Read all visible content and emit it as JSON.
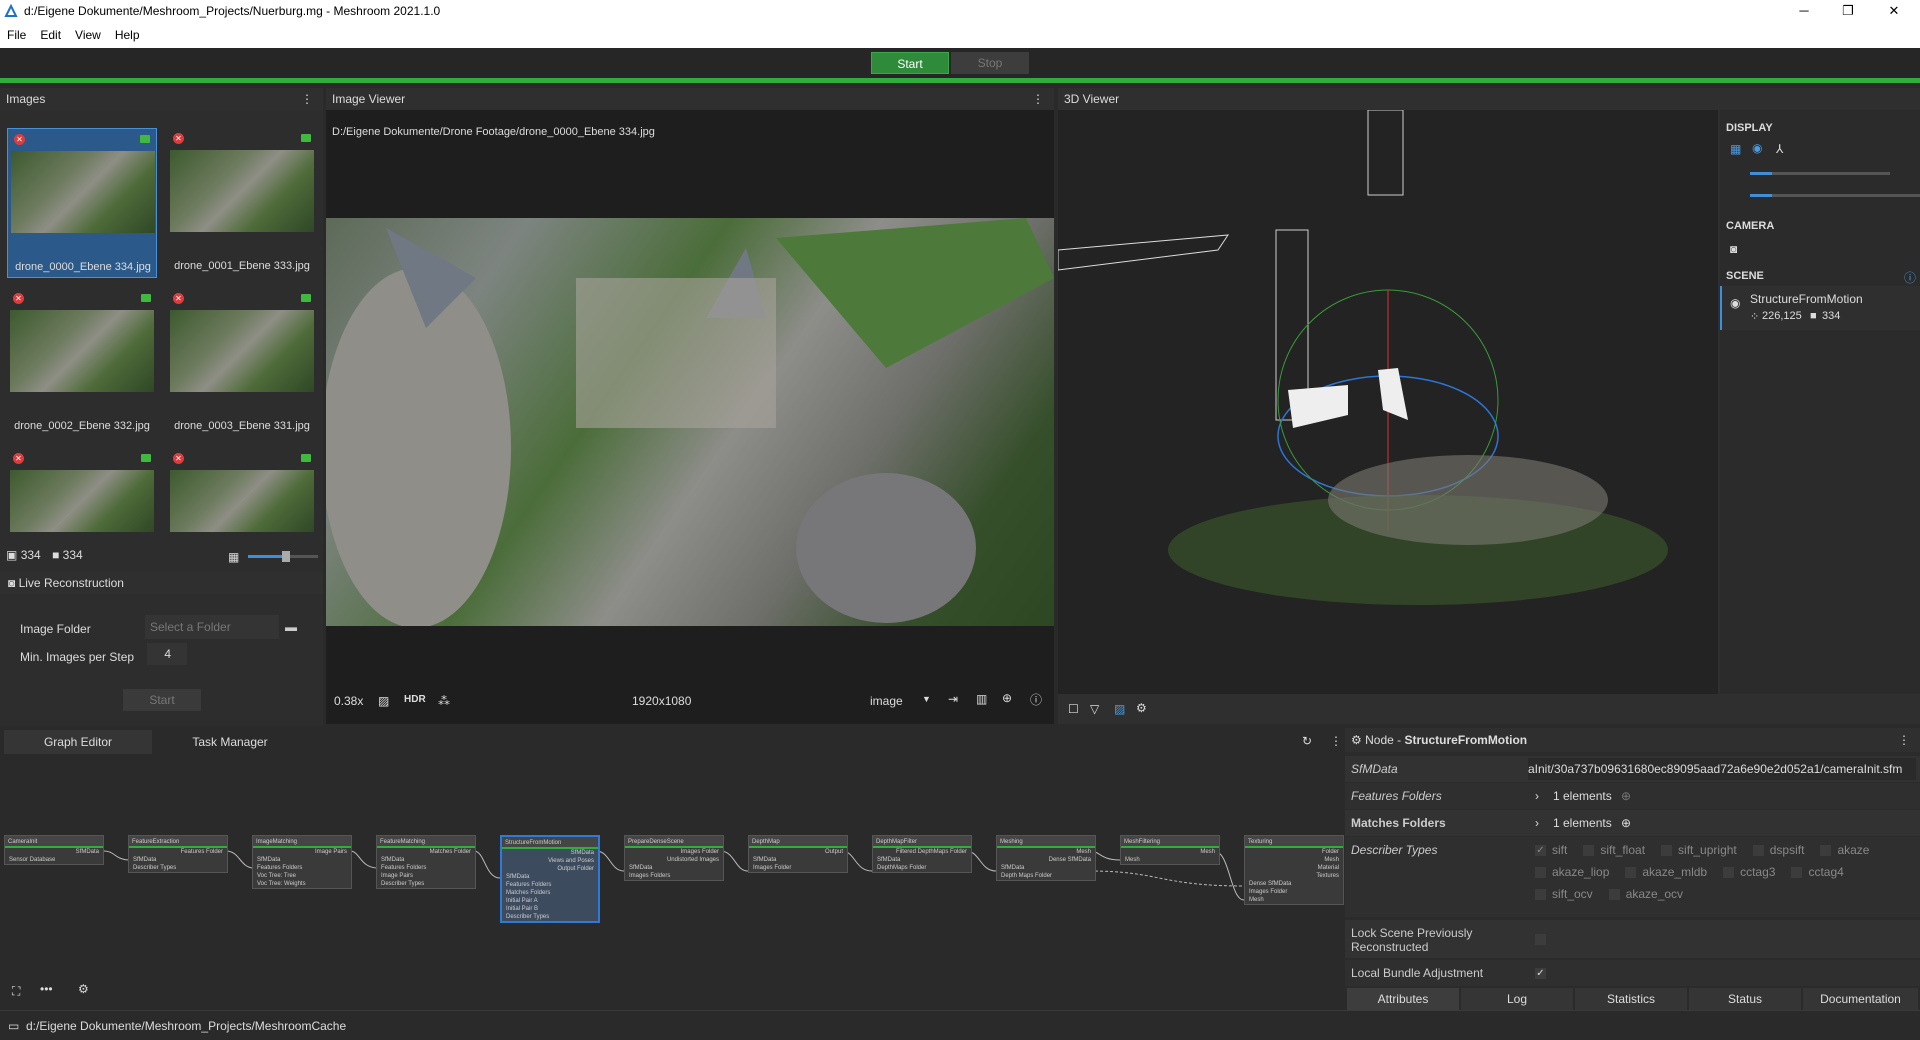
{
  "window": {
    "title": "d:/Eigene Dokumente/Meshroom_Projects/Nuerburg.mg - Meshroom 2021.1.0",
    "minimize": "─",
    "maximize": "❐",
    "close": "✕"
  },
  "menu": [
    "File",
    "Edit",
    "View",
    "Help"
  ],
  "toolbar": {
    "start": "Start",
    "stop": "Stop"
  },
  "images": {
    "header": "Images",
    "items": [
      {
        "label": "drone_0000_Ebene 334.jpg",
        "selected": true
      },
      {
        "label": "drone_0001_Ebene 333.jpg"
      },
      {
        "label": "drone_0002_Ebene 332.jpg"
      },
      {
        "label": "drone_0003_Ebene 331.jpg"
      },
      {
        "label": ""
      },
      {
        "label": ""
      }
    ],
    "image_count": "334",
    "camera_count": "334",
    "live": {
      "title": "Live Reconstruction",
      "folder_label": "Image Folder",
      "folder_placeholder": "Select a Folder",
      "min_label": "Min. Images per Step",
      "min_value": "4",
      "start": "Start"
    }
  },
  "image_viewer": {
    "header": "Image Viewer",
    "path": "D:/Eigene Dokumente/Drone Footage/drone_0000_Ebene 334.jpg",
    "zoom": "0.38x",
    "hdr": "HDR",
    "resolution": "1920x1080",
    "mode": "image"
  },
  "viewer3d": {
    "header": "3D Viewer",
    "display": "DISPLAY",
    "camera": "CAMERA",
    "scene": "SCENE",
    "scene_item": "StructureFromMotion",
    "points": "226,125",
    "cameras": "334"
  },
  "graph": {
    "tabs": [
      "Graph Editor",
      "Task Manager"
    ],
    "nodes": [
      {
        "name": "CameraInit",
        "inputs": [
          "Sensor Database"
        ],
        "outputs": [
          "SfMData"
        ]
      },
      {
        "name": "FeatureExtraction",
        "inputs": [
          "SfMData",
          "Describer Types"
        ],
        "outputs": [
          "Features Folder"
        ]
      },
      {
        "name": "ImageMatching",
        "inputs": [
          "SfMData",
          "Features Folders",
          "Voc Tree: Tree",
          "Voc Tree: Weights"
        ],
        "outputs": [
          "Image Pairs"
        ]
      },
      {
        "name": "FeatureMatching",
        "inputs": [
          "SfMData",
          "Features Folders",
          "Image Pairs",
          "Describer Types"
        ],
        "outputs": [
          "Matches Folder"
        ]
      },
      {
        "name": "StructureFromMotion",
        "inputs": [
          "SfMData",
          "Features Folders",
          "Matches Folders",
          "Initial Pair A",
          "Initial Pair B",
          "Describer Types"
        ],
        "outputs": [
          "SfMData",
          "Views and Poses",
          "Output Folder"
        ]
      },
      {
        "name": "PrepareDenseScene",
        "inputs": [
          "SfMData",
          "Images Folders"
        ],
        "outputs": [
          "Images Folder",
          "Undistorted Images"
        ]
      },
      {
        "name": "DepthMap",
        "inputs": [
          "SfMData",
          "Images Folder"
        ],
        "outputs": [
          "Output"
        ]
      },
      {
        "name": "DepthMapFilter",
        "inputs": [
          "SfMData",
          "DepthMaps Folder"
        ],
        "outputs": [
          "Filtered DepthMaps Folder"
        ]
      },
      {
        "name": "Meshing",
        "inputs": [
          "SfMData",
          "Depth Maps Folder"
        ],
        "outputs": [
          "Mesh",
          "Dense SfMData"
        ]
      },
      {
        "name": "MeshFiltering",
        "inputs": [
          "Mesh"
        ],
        "outputs": [
          "Mesh"
        ]
      },
      {
        "name": "Texturing",
        "inputs": [
          "Dense SfMData",
          "Images Folder",
          "Mesh"
        ],
        "outputs": [
          "Folder",
          "Mesh",
          "Material",
          "Textures"
        ]
      }
    ]
  },
  "node": {
    "header_prefix": "Node - ",
    "header_name": "StructureFromMotion",
    "sfm_label": "SfMData",
    "sfm_value": "aInit/30a737b09631680ec89095aad72a6e90e2d052a1/cameraInit.sfm",
    "features_label": "Features Folders",
    "features_value": "1 elements",
    "matches_label": "Matches Folders",
    "matches_value": "1 elements",
    "describer_label": "Describer Types",
    "describers": [
      "sift",
      "sift_float",
      "sift_upright",
      "dspsift",
      "akaze",
      "akaze_liop",
      "akaze_mldb",
      "cctag3",
      "cctag4",
      "sift_ocv",
      "akaze_ocv"
    ],
    "lock_label": "Lock Scene Previously Reconstructed",
    "bundle_label": "Local Bundle Adjustment",
    "check": "✓",
    "tabs": [
      "Attributes",
      "Log",
      "Statistics",
      "Status",
      "Documentation"
    ]
  },
  "status": {
    "path": "d:/Eigene Dokumente/Meshroom_Projects/MeshroomCache"
  }
}
